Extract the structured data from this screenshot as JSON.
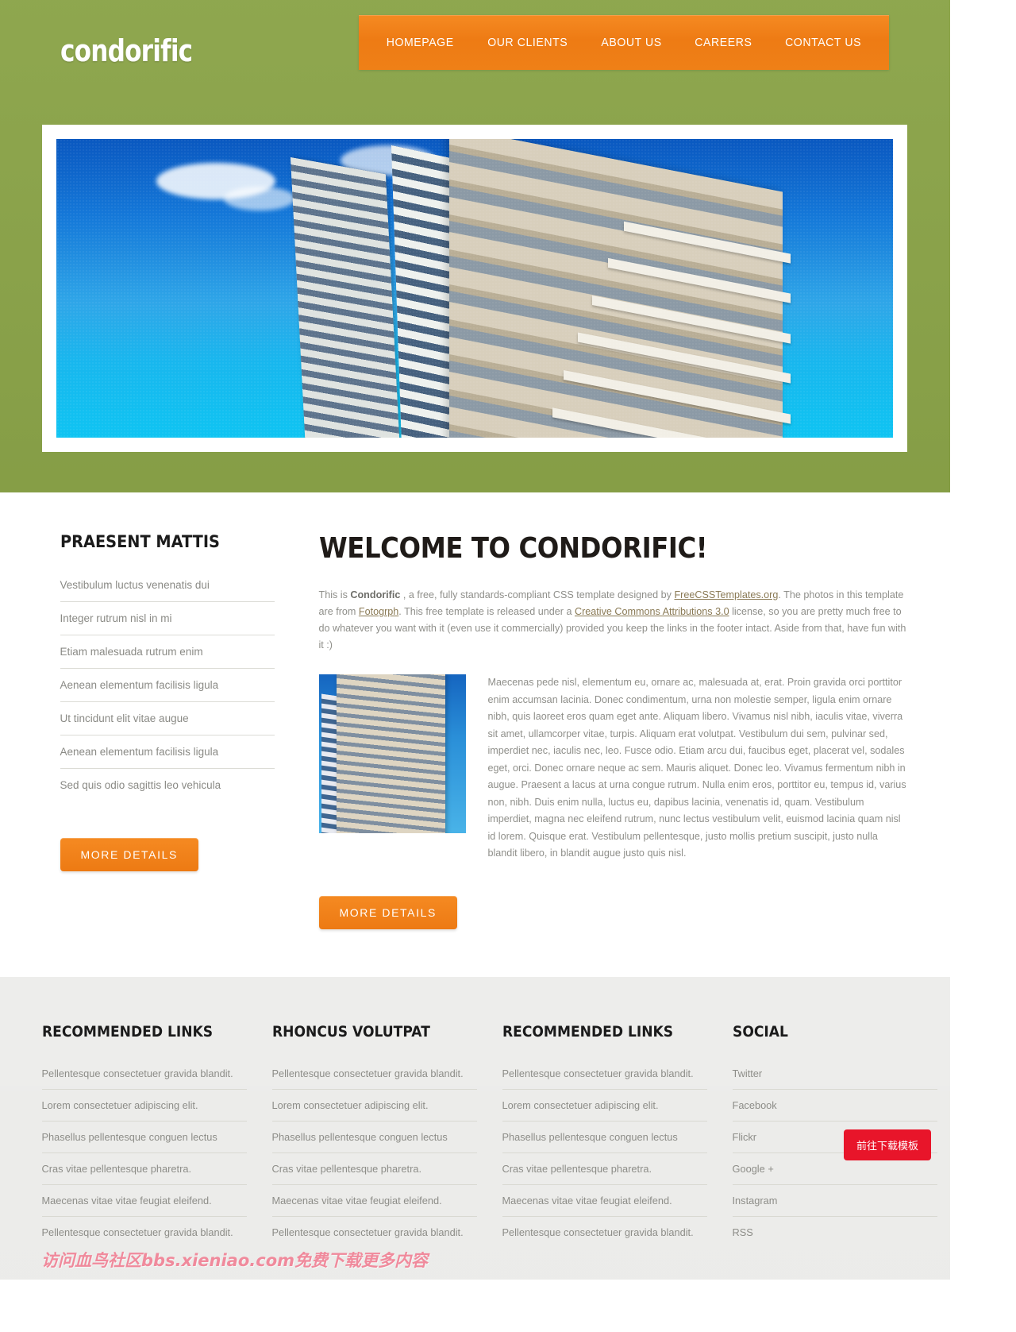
{
  "site": {
    "logo": "condorific",
    "brand_green": "#8ba449",
    "brand_orange": "#f07c18"
  },
  "nav": {
    "items": [
      {
        "label": "HOMEPAGE"
      },
      {
        "label": "OUR CLIENTS"
      },
      {
        "label": "ABOUT US"
      },
      {
        "label": "CAREERS"
      },
      {
        "label": "CONTACT US"
      }
    ]
  },
  "sidebar": {
    "title": "PRAESENT MATTIS",
    "items": [
      {
        "label": "Vestibulum luctus venenatis dui"
      },
      {
        "label": "Integer rutrum nisl in mi"
      },
      {
        "label": "Etiam malesuada rutrum enim"
      },
      {
        "label": "Aenean elementum facilisis ligula"
      },
      {
        "label": "Ut tincidunt elit vitae augue"
      },
      {
        "label": "Aenean elementum facilisis ligula"
      },
      {
        "label": "Sed quis odio sagittis leo vehicula"
      }
    ],
    "more_button": "MORE DETAILS"
  },
  "content": {
    "title": "WELCOME TO CONDORIFIC!",
    "intro": {
      "p1_a": "This is ",
      "p1_brand": "Condorific",
      "p1_b": " , a free, fully standards-compliant CSS template designed by ",
      "link1": "FreeCSSTemplates.org",
      "p1_c": ". The photos in this template are from ",
      "link2": "Fotogrph",
      "p1_d": ". This free template is released under a ",
      "link3": "Creative Commons Attributions 3.0",
      "p1_e": " license, so you are pretty much free to do whatever you want with it (even use it commercially) provided you keep the links in the footer intact. Aside from that, have fun with it :)"
    },
    "body": "Maecenas pede nisl, elementum eu, ornare ac, malesuada at, erat. Proin gravida orci porttitor enim accumsan lacinia. Donec condimentum, urna non molestie semper, ligula enim ornare nibh, quis laoreet eros quam eget ante. Aliquam libero. Vivamus nisl nibh, iaculis vitae, viverra sit amet, ullamcorper vitae, turpis. Aliquam erat volutpat. Vestibulum dui sem, pulvinar sed, imperdiet nec, iaculis nec, leo. Fusce odio. Etiam arcu dui, faucibus eget, placerat vel, sodales eget, orci. Donec ornare neque ac sem. Mauris aliquet. Donec leo. Vivamus fermentum nibh in augue. Praesent a lacus at urna congue rutrum. Nulla enim eros, porttitor eu, tempus id, varius non, nibh. Duis enim nulla, luctus eu, dapibus lacinia, venenatis id, quam. Vestibulum imperdiet, magna nec eleifend rutrum, nunc lectus vestibulum velit, euismod lacinia quam nisl id lorem. Quisque erat. Vestibulum pellentesque, justo mollis pretium suscipit, justo nulla blandit libero, in blandit augue justo quis nisl.",
    "more_button": "MORE DETAILS"
  },
  "footer": {
    "columns": [
      {
        "title": "RECOMMENDED LINKS",
        "items": [
          {
            "label": "Pellentesque consectetuer gravida blandit."
          },
          {
            "label": "Lorem consectetuer adipiscing elit."
          },
          {
            "label": "Phasellus pellentesque conguen lectus"
          },
          {
            "label": "Cras vitae pellentesque pharetra."
          },
          {
            "label": "Maecenas vitae vitae feugiat eleifend."
          },
          {
            "label": "Pellentesque consectetuer gravida blandit."
          }
        ]
      },
      {
        "title": "RHONCUS VOLUTPAT",
        "items": [
          {
            "label": "Pellentesque consectetuer gravida blandit."
          },
          {
            "label": "Lorem consectetuer adipiscing elit."
          },
          {
            "label": "Phasellus pellentesque conguen lectus"
          },
          {
            "label": "Cras vitae pellentesque pharetra."
          },
          {
            "label": "Maecenas vitae vitae feugiat eleifend."
          },
          {
            "label": "Pellentesque consectetuer gravida blandit."
          }
        ]
      },
      {
        "title": "RECOMMENDED LINKS",
        "items": [
          {
            "label": "Pellentesque consectetuer gravida blandit."
          },
          {
            "label": "Lorem consectetuer adipiscing elit."
          },
          {
            "label": "Phasellus pellentesque conguen lectus"
          },
          {
            "label": "Cras vitae pellentesque pharetra."
          },
          {
            "label": "Maecenas vitae vitae feugiat eleifend."
          },
          {
            "label": "Pellentesque consectetuer gravida blandit."
          }
        ]
      },
      {
        "title": "SOCIAL",
        "items": [
          {
            "label": "Twitter"
          },
          {
            "label": "Facebook"
          },
          {
            "label": "Flickr"
          },
          {
            "label": "Google +"
          },
          {
            "label": "Instagram"
          },
          {
            "label": "RSS"
          }
        ]
      }
    ]
  },
  "overlay": {
    "watermark": "访问血鸟社区bbs.xieniao.com免费下载更多内容",
    "download_button": "前往下载模板",
    "download_color": "#e8152a"
  }
}
